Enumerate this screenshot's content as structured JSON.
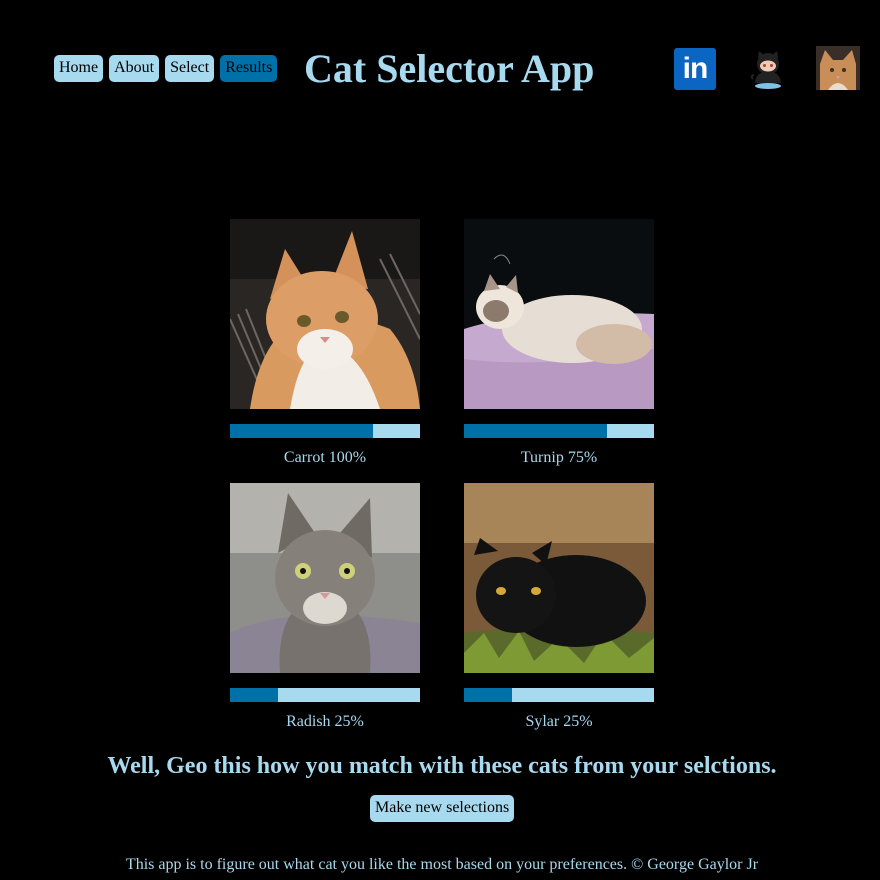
{
  "nav": {
    "items": [
      {
        "label": "Home",
        "active": false
      },
      {
        "label": "About",
        "active": false
      },
      {
        "label": "Select",
        "active": false
      },
      {
        "label": "Results",
        "active": true
      }
    ]
  },
  "header": {
    "title": "Cat Selector App"
  },
  "social": {
    "linkedin_icon": "linkedin-icon",
    "linkedin_text": "in",
    "github_icon": "github-octocat-icon",
    "profile_icon": "cat-photo-icon"
  },
  "results": [
    {
      "name": "Carrot",
      "percent": 100,
      "label": "Carrot 100%",
      "bar_fraction": 0.75
    },
    {
      "name": "Turnip",
      "percent": 75,
      "label": "Turnip 75%",
      "bar_fraction": 0.75
    },
    {
      "name": "Radish",
      "percent": 25,
      "label": "Radish 25%",
      "bar_fraction": 0.25
    },
    {
      "name": "Sylar",
      "percent": 25,
      "label": "Sylar 25%",
      "bar_fraction": 0.25
    }
  ],
  "summary": "Well, Geo this how you match with these cats from your selctions.",
  "actions": {
    "new_selection_label": "Make new selections"
  },
  "footer": "This app is to figure out what cat you like the most based on your preferences. © George Gaylor Jr",
  "colors": {
    "background": "#000000",
    "accent_light": "#a7d9ef",
    "accent_dark": "#0070a8"
  }
}
